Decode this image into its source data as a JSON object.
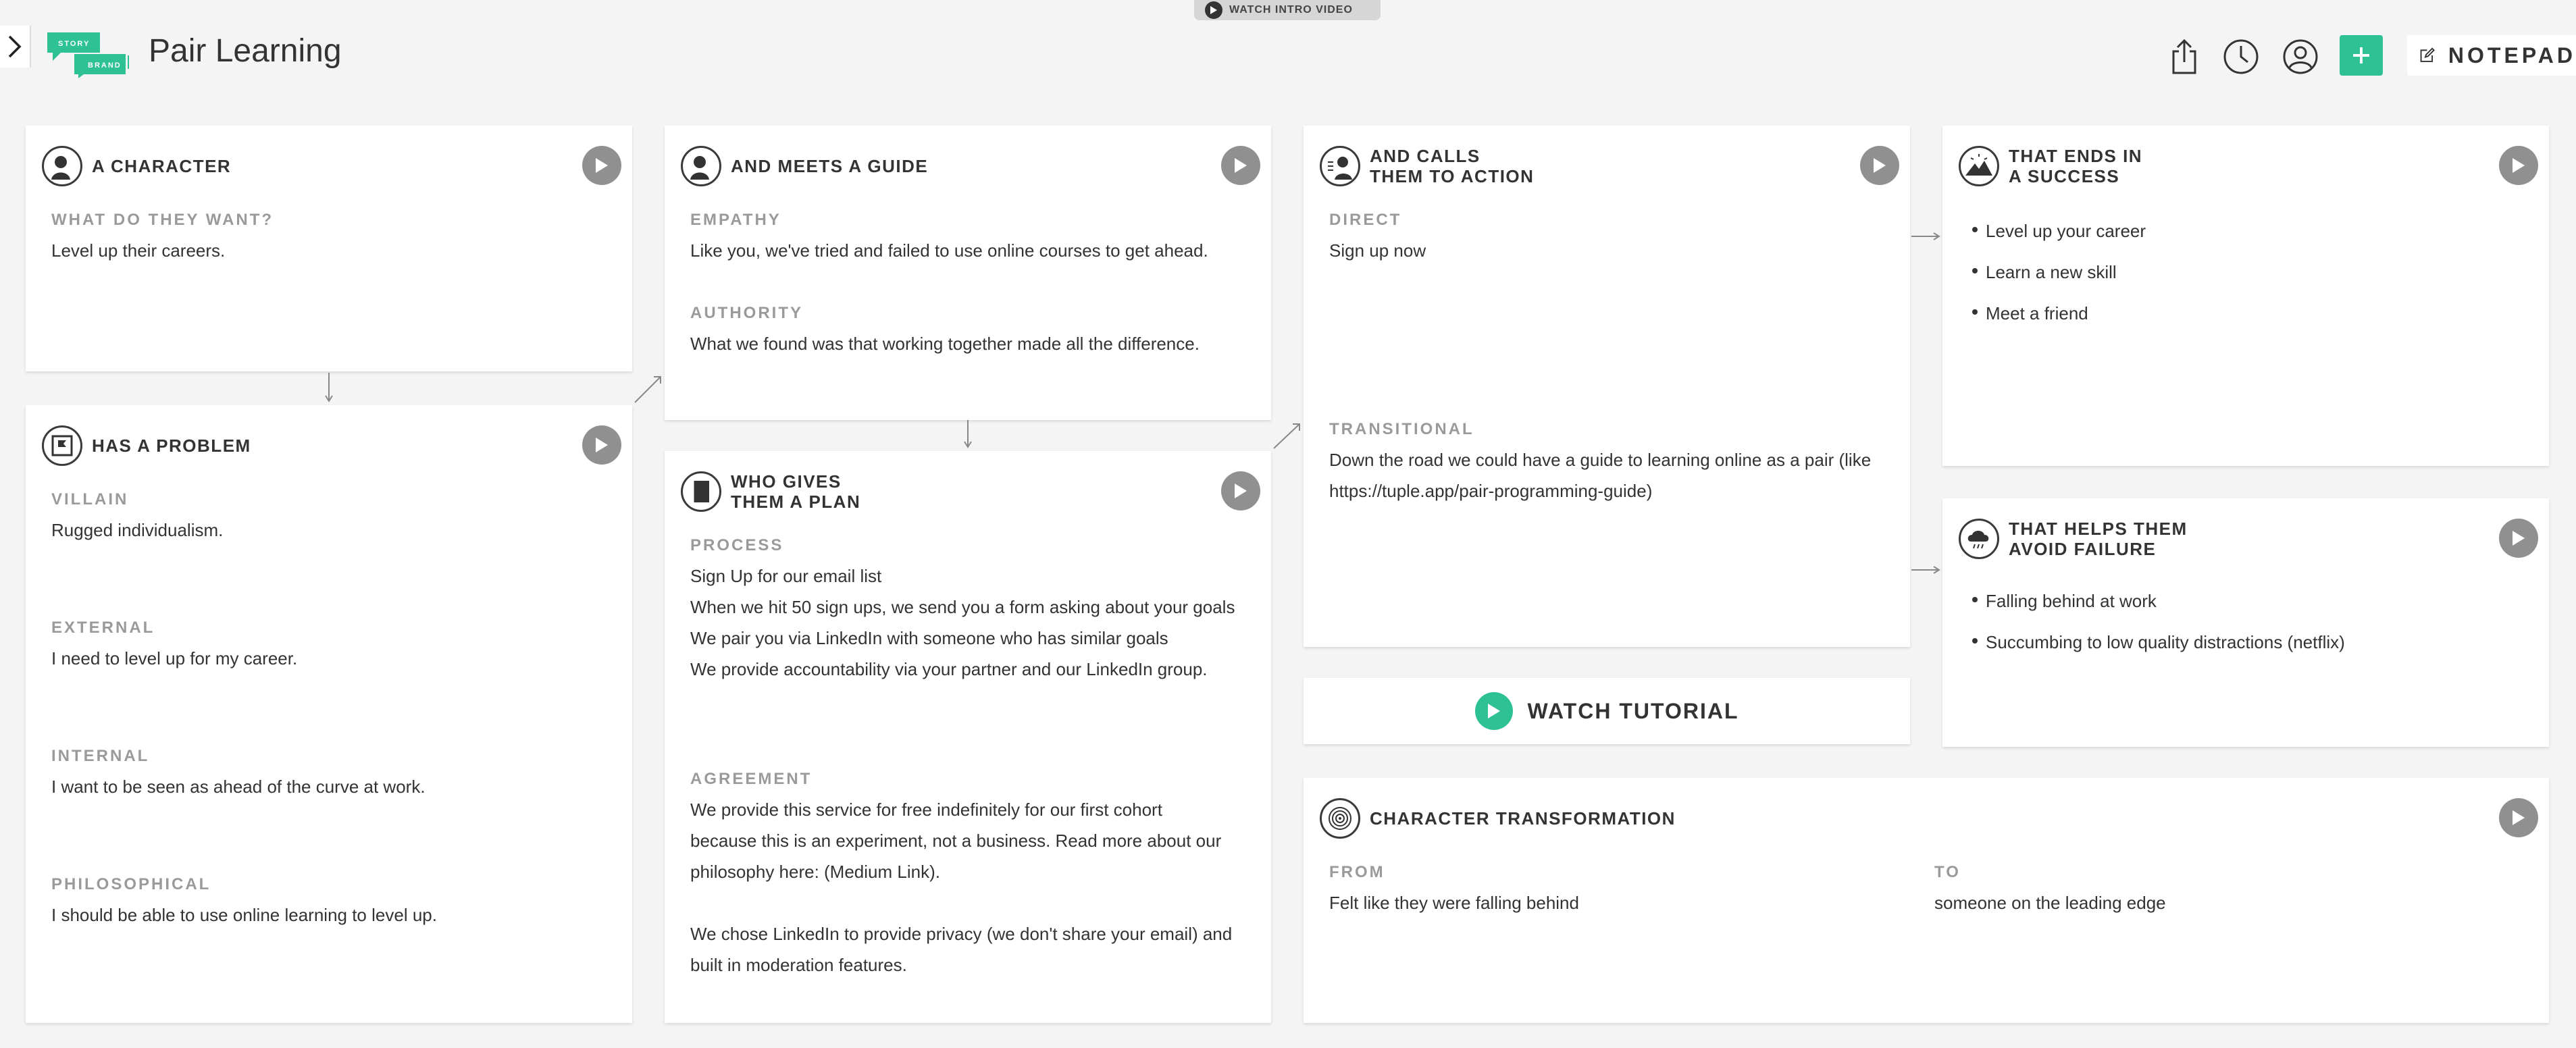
{
  "header": {
    "title": "Pair Learning",
    "intro_video": "WATCH INTRO VIDEO",
    "notepad": "NOTEPAD",
    "logo_top": "STORY",
    "logo_bottom": "BRAND"
  },
  "colors": {
    "accent": "#2dc194",
    "play": "#909090",
    "background": "#f4f4f4"
  },
  "character": {
    "title": "A CHARACTER",
    "want_label": "WHAT DO THEY WANT?",
    "want": "Level up their careers."
  },
  "problem": {
    "title": "HAS A PROBLEM",
    "villain_label": "VILLAIN",
    "villain": "Rugged individualism.",
    "external_label": "EXTERNAL",
    "external": "I need to level up for my career.",
    "internal_label": "INTERNAL",
    "internal": "I want to be seen as ahead of the curve at work.",
    "philosophical_label": "PHILOSOPHICAL",
    "philosophical": "I should be able to use online learning to level up."
  },
  "guide": {
    "title": "AND MEETS A GUIDE",
    "empathy_label": "EMPATHY",
    "empathy": "Like you, we've tried and failed to use online courses to get ahead.",
    "authority_label": "AUTHORITY",
    "authority": "What we found was that working together made all the difference."
  },
  "plan": {
    "title_line1": "WHO GIVES",
    "title_line2": "THEM A PLAN",
    "process_label": "PROCESS",
    "process": [
      "Sign Up for our email list",
      "When we hit 50 sign ups, we send you a form asking about your goals",
      "We pair you via LinkedIn with someone who has similar goals",
      "We provide accountability via your partner and our LinkedIn group."
    ],
    "agreement_label": "AGREEMENT",
    "agreement_lines": [
      "We provide this service for free indefinitely for our first cohort",
      "because this is an experiment, not a business. Read more about our",
      "philosophy here: (Medium Link).",
      "",
      "We chose LinkedIn to provide privacy (we don't share your email) and",
      "built in moderation features."
    ]
  },
  "action": {
    "title_line1": "AND CALLS",
    "title_line2": "THEM TO ACTION",
    "direct_label": "DIRECT",
    "direct": "Sign up now",
    "transitional_label": "TRANSITIONAL",
    "transitional_lines": [
      "Down the road we could have a guide to learning online as a pair (like",
      "https://tuple.app/pair-programming-guide)"
    ]
  },
  "tutorial": {
    "label": "WATCH TUTORIAL"
  },
  "success": {
    "title_line1": "THAT ENDS IN",
    "title_line2": "A SUCCESS",
    "items": [
      "Level up your career",
      "Learn a new skill",
      "Meet a friend"
    ]
  },
  "failure": {
    "title_line1": "THAT HELPS THEM",
    "title_line2": "AVOID FAILURE",
    "items": [
      "Falling behind at work",
      "Succumbing to low quality distractions (netflix)"
    ]
  },
  "transformation": {
    "title": "CHARACTER TRANSFORMATION",
    "from_label": "FROM",
    "from": "Felt like they were falling behind",
    "to_label": "TO",
    "to": "someone on the leading edge"
  }
}
